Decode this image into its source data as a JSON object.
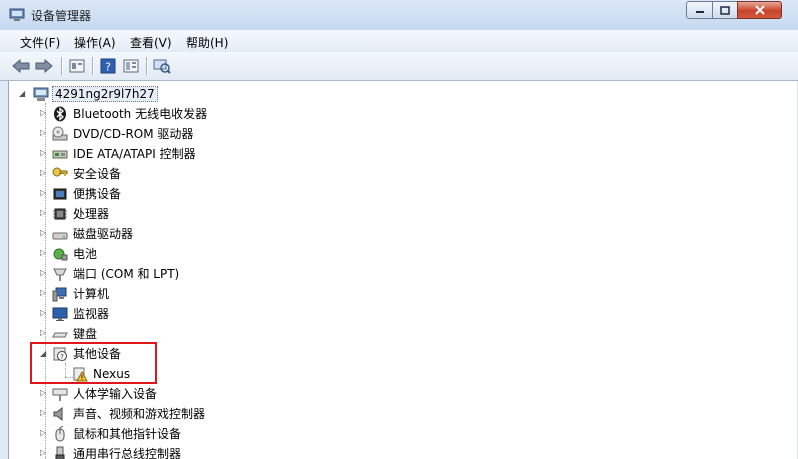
{
  "window": {
    "title": "设备管理器",
    "controls": {
      "minimize": "minimize",
      "maximize": "maximize",
      "close": "close"
    }
  },
  "menu": [
    {
      "label": "文件(F)"
    },
    {
      "label": "操作(A)"
    },
    {
      "label": "查看(V)"
    },
    {
      "label": "帮助(H)"
    }
  ],
  "toolbar": {
    "icons": [
      "back-arrow-icon",
      "forward-arrow-icon",
      "properties-icon",
      "help-icon",
      "show-hide-tree-icon",
      "scan-hardware-icon"
    ]
  },
  "tree": {
    "root": {
      "label": "4291ng2r9l7h27",
      "icon": "computer-icon"
    },
    "items": [
      {
        "label": "Bluetooth 无线电收发器",
        "icon": "bluetooth-icon",
        "expanded": false
      },
      {
        "label": "DVD/CD-ROM 驱动器",
        "icon": "dvd-drive-icon",
        "expanded": false
      },
      {
        "label": "IDE ATA/ATAPI 控制器",
        "icon": "ide-controller-icon",
        "expanded": false
      },
      {
        "label": "安全设备",
        "icon": "security-key-icon",
        "expanded": false
      },
      {
        "label": "便携设备",
        "icon": "portable-device-icon",
        "expanded": false
      },
      {
        "label": "处理器",
        "icon": "processor-icon",
        "expanded": false
      },
      {
        "label": "磁盘驱动器",
        "icon": "disk-drive-icon",
        "expanded": false
      },
      {
        "label": "电池",
        "icon": "battery-icon",
        "expanded": false
      },
      {
        "label": "端口 (COM 和 LPT)",
        "icon": "port-icon",
        "expanded": false
      },
      {
        "label": "计算机",
        "icon": "computer-icon",
        "expanded": false
      },
      {
        "label": "监视器",
        "icon": "monitor-icon",
        "expanded": false
      },
      {
        "label": "键盘",
        "icon": "keyboard-icon",
        "expanded": false
      },
      {
        "label": "其他设备",
        "icon": "unknown-device-icon",
        "expanded": true
      },
      {
        "label": "Nexus",
        "icon": "warning-device-icon",
        "child": true
      },
      {
        "label": "人体学输入设备",
        "icon": "hid-icon",
        "expanded": false
      },
      {
        "label": "声音、视频和游戏控制器",
        "icon": "speaker-icon",
        "expanded": false
      },
      {
        "label": "鼠标和其他指针设备",
        "icon": "mouse-icon",
        "expanded": false
      },
      {
        "label": "通用串行总线控制器",
        "icon": "usb-icon",
        "expanded": false
      }
    ]
  },
  "colors": {
    "highlight_box": "#e0161c",
    "titlebar": "#c6d9f0"
  }
}
